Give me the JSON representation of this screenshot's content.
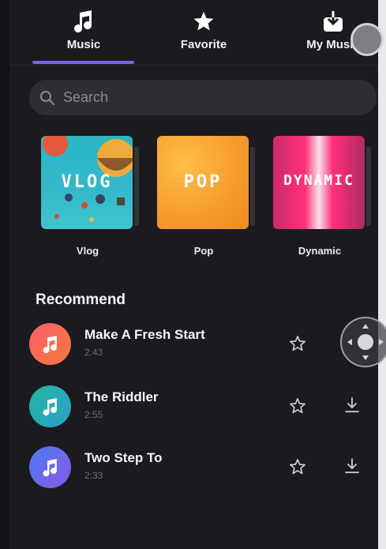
{
  "tabs": [
    {
      "label": "Music",
      "icon": "music-note-icon",
      "selected": true
    },
    {
      "label": "Favorite",
      "icon": "star-icon",
      "selected": false
    },
    {
      "label": "My Music",
      "icon": "download-box-icon",
      "selected": false
    }
  ],
  "search": {
    "placeholder": "Search"
  },
  "albums": [
    {
      "name": "Vlog",
      "cover_text": "VLOG"
    },
    {
      "name": "Pop",
      "cover_text": "POP"
    },
    {
      "name": "Dynamic",
      "cover_text": "DYNAMIC"
    }
  ],
  "section": {
    "title": "Recommend"
  },
  "songs": [
    {
      "title": "Make A Fresh Start",
      "duration": "2:43"
    },
    {
      "title": "The Riddler",
      "duration": "2:55"
    },
    {
      "title": "Two Step To",
      "duration": "2:33"
    }
  ],
  "colors": {
    "accent": "#7467e6",
    "background": "#1b1a1f",
    "search_bg": "#2e2d33"
  }
}
